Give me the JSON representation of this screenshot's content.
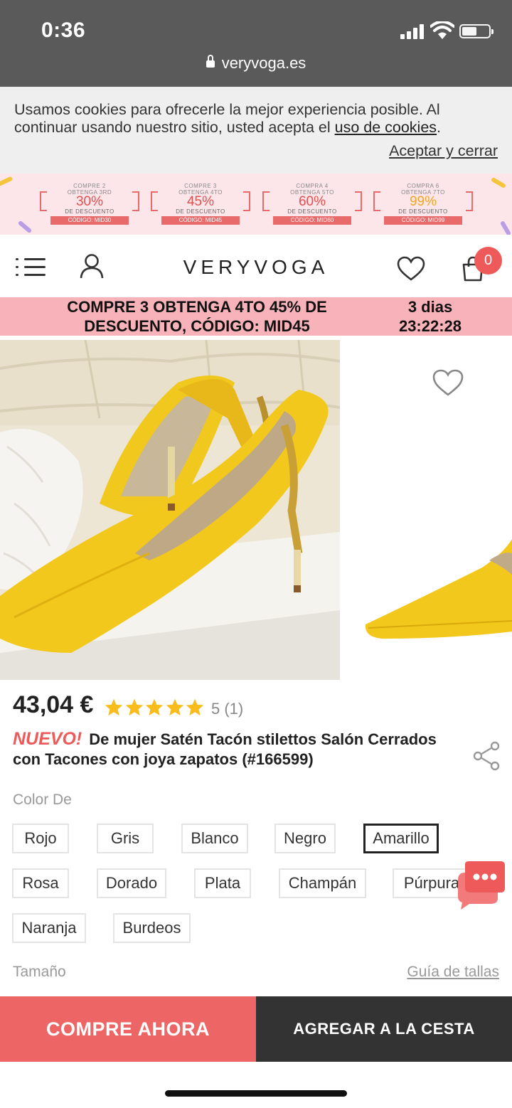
{
  "status_bar": {
    "time": "0:36",
    "url": "veryvoga.es"
  },
  "cookies": {
    "text": "Usamos cookies para ofrecerle la mejor experiencia posible. Al continuar usando nuestro sitio, usted acepta el ",
    "link": "uso de cookies",
    "suffix": ".",
    "accept": "Aceptar y cerrar"
  },
  "promo": {
    "tiles": [
      {
        "line1": "COMPRE 2",
        "line2": "OBTENGA 3RD",
        "pct": "30%",
        "line3": "DE DESCUENTO",
        "code": "CÓDIGO: MID30"
      },
      {
        "line1": "COMPRE 3",
        "line2": "OBTENGA 4TO",
        "pct": "45%",
        "line3": "DE DESCUENTO",
        "code": "CÓDIGO: MID45"
      },
      {
        "line1": "COMPRA 4",
        "line2": "OBTENGA 5TO",
        "pct": "60%",
        "line3": "DE DESCUENTO",
        "code": "CÓDIGO: MID60"
      },
      {
        "line1": "COMPRA 6",
        "line2": "OBTENGA 7TO",
        "pct": "99%",
        "line3": "DE DESCUENTO",
        "code": "CÓDIGO: MID99"
      }
    ]
  },
  "header": {
    "logo": "VERYVOGA",
    "cart_count": "0"
  },
  "countdown": {
    "message_line1": "COMPRE 3 OBTENGA 4TO 45% DE",
    "message_line2": "DESCUENTO, CÓDIGO: MID45",
    "timer_line1": "3 dias",
    "timer_line2": "23:22:28"
  },
  "product": {
    "price": "43,04 €",
    "rating": "5 (1)",
    "stars": 5,
    "badge": "NUEVO!",
    "title": "De mujer Satén Tacón stilettos Salón Cerrados con Tacones con joya zapatos (#166599)",
    "color_label": "Color De",
    "colors": [
      "Rojo",
      "Gris",
      "Blanco",
      "Negro",
      "Amarillo",
      "Rosa",
      "Dorado",
      "Plata",
      "Champán",
      "Púrpura",
      "Naranja",
      "Burdeos"
    ],
    "selected_color": "Amarillo",
    "size_label": "Tamaño",
    "size_guide": "Guía de tallas"
  },
  "actions": {
    "buy_now": "COMPRE AHORA",
    "add_to_cart": "AGREGAR A LA CESTA"
  },
  "colors": {
    "accent": "#ee5a5a",
    "strip": "#f7b3b9",
    "dark": "#333333",
    "status_bar": "#5a5a5a"
  }
}
